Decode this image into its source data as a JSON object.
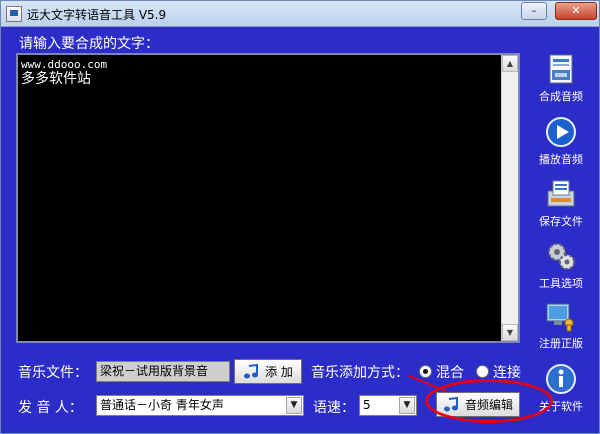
{
  "window": {
    "title": "远大文字转语音工具 V5.9",
    "controls": {
      "minimize": "–",
      "maximize": "□",
      "close": "✕"
    }
  },
  "editor": {
    "prompt": "请输入要合成的文字：",
    "lines": [
      "www.ddooo.com",
      "多多软件站"
    ]
  },
  "toolbar": [
    {
      "id": "synthesize",
      "label": "合成音频",
      "icon": "audio-file-icon"
    },
    {
      "id": "play",
      "label": "播放音频",
      "icon": "play-icon"
    },
    {
      "id": "save",
      "label": "保存文件",
      "icon": "save-file-icon"
    },
    {
      "id": "options",
      "label": "工具选项",
      "icon": "gears-icon"
    },
    {
      "id": "register",
      "label": "注册正版",
      "icon": "register-icon"
    },
    {
      "id": "about",
      "label": "关于软件",
      "icon": "info-icon"
    }
  ],
  "music": {
    "label": "音乐文件：",
    "file_value": "梁祝－试用版背景音",
    "add_button": "添 加",
    "mode_label": "音乐添加方式：",
    "modes": [
      {
        "label": "混合",
        "selected": true
      },
      {
        "label": "连接",
        "selected": false
      }
    ]
  },
  "voice": {
    "label": "发 音 人：",
    "selected": "普通话－小奇 青年女声",
    "speed_label": "语速：",
    "speed_value": "5",
    "edit_button": "音频编辑"
  },
  "colors": {
    "background": "#2c2cc8",
    "editor_bg": "#000000",
    "highlight": "#e60012"
  }
}
